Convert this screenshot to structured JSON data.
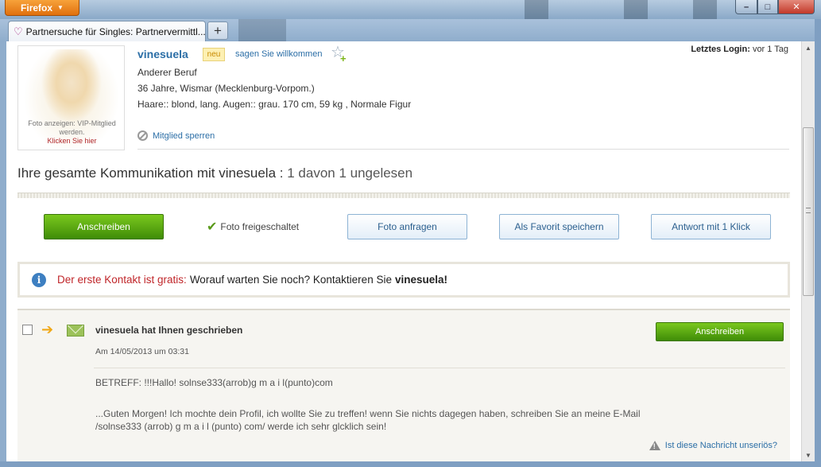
{
  "browser": {
    "app_button": "Firefox",
    "tab_title": "Partnersuche für Singles: Partnervermittl...",
    "new_tab": "+",
    "win_min": "–",
    "win_max": "□",
    "win_close": "✕"
  },
  "profile": {
    "photo_note_line1": "Foto anzeigen: VIP-Mitglied",
    "photo_note_line2": "werden.",
    "photo_note_link": "Klicken Sie hier",
    "username": "vinesuela",
    "badge_new": "neu",
    "welcome_link": "sagen Sie willkommen",
    "last_login_label": "Letztes Login:",
    "last_login_value": "vor 1 Tag",
    "occupation": "Anderer Beruf",
    "age_location": "36 Jahre, Wismar (Mecklenburg-Vorpom.)",
    "details": "Haare:: blond, lang. Augen:: grau. 170 cm, 59 kg , Normale Figur",
    "block_link": "Mitglied sperren"
  },
  "communication": {
    "title": "Ihre gesamte Kommunikation mit vinesuela :",
    "count": "1 davon 1 ungelesen"
  },
  "actions": {
    "write": "Anschreiben",
    "photo_unlocked": "Foto freigeschaltet",
    "request_photo": "Foto anfragen",
    "save_favorite": "Als Favorit speichern",
    "one_click_reply": "Antwort mit 1 Klick"
  },
  "info": {
    "highlight": "Der erste Kontakt ist gratis:",
    "text": "Worauf warten Sie noch? Kontaktieren Sie",
    "name": "vinesuela!"
  },
  "message": {
    "header": "vinesuela hat Ihnen geschrieben",
    "date": "Am 14/05/2013 um 03:31",
    "reply_button": "Anschreiben",
    "subject": "BETREFF: !!!Hallo! solnse333(arrob)g m a i l(punto)com",
    "body_line1": "...Guten Morgen! Ich mochte dein Profil, ich wollte Sie zu treffen! wenn Sie nichts dagegen haben, schreiben Sie an meine E-Mail",
    "body_line2": "/solnse333 (arrob) g m a i l (punto) com/ werde ich sehr glcklich sein!",
    "report_link": "Ist diese Nachricht unseriös?"
  },
  "colors": {
    "link": "#2b6ea6",
    "green_button": "#5aa812",
    "alert_red": "#c0262a"
  }
}
